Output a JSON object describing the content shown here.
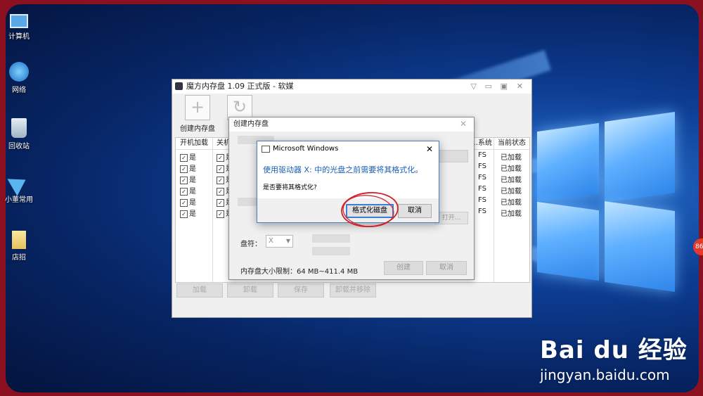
{
  "desktop": {
    "icons": [
      {
        "label": "计算机",
        "icon": "computer-icon"
      },
      {
        "label": "网络",
        "icon": "network-icon"
      },
      {
        "label": "回收站",
        "icon": "recycle-bin-icon"
      },
      {
        "label": "小董常用",
        "icon": "folder-shortcut-icon"
      },
      {
        "label": "店招",
        "icon": "document-icon"
      }
    ],
    "badge": "86"
  },
  "app": {
    "title": "魔方内存盘 1.09 正式版 - 软媒",
    "toolbar": [
      "创建内存盘"
    ],
    "columns": [
      "开机加载",
      "关机…",
      "…系统",
      "当前状态"
    ],
    "rows": [
      {
        "boot": "是",
        "shutdown": "是",
        "fs": "FS",
        "status": "已加载"
      },
      {
        "boot": "是",
        "shutdown": "是",
        "fs": "FS",
        "status": "已加载"
      },
      {
        "boot": "是",
        "shutdown": "是",
        "fs": "FS",
        "status": "已加载"
      },
      {
        "boot": "是",
        "shutdown": "是",
        "fs": "FS",
        "status": "已加载"
      },
      {
        "boot": "是",
        "shutdown": "是",
        "fs": "FS",
        "status": "已加载"
      },
      {
        "boot": "是",
        "shutdown": "是",
        "fs": "FS",
        "status": "已加载"
      }
    ],
    "buttons": [
      "加载",
      "卸载",
      "保存",
      "卸载并移除"
    ]
  },
  "create_dialog": {
    "title": "创建内存盘",
    "drive_label": "盘符：",
    "drive_value": "X",
    "size_limit": "内存盘大小限制：64 MB~411.4 MB",
    "open_button": "打开...",
    "create_button": "创建",
    "cancel_button": "取消"
  },
  "ms_dialog": {
    "title": "Microsoft Windows",
    "message": "使用驱动器 X: 中的光盘之前需要将其格式化。",
    "question": "是否要将其格式化?",
    "format_button": "格式化磁盘",
    "cancel_button": "取消",
    "highlight_color": "#d11f2a",
    "accent_color": "#1a5fb4"
  },
  "watermark": {
    "brand": "Bai du 经验",
    "url": "jingyan.baidu.com"
  }
}
